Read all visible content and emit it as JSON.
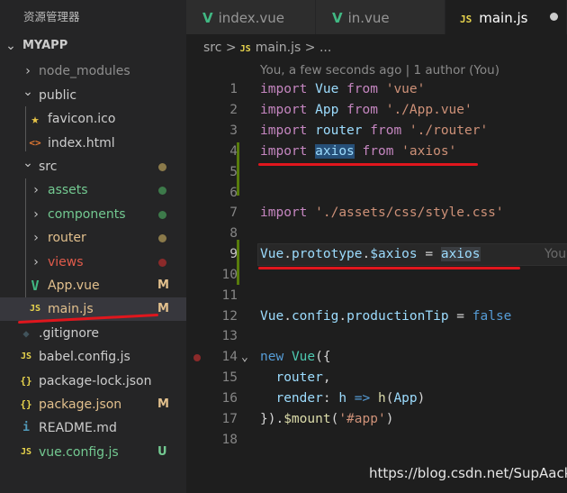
{
  "explorer": {
    "title": "资源管理器",
    "project": "MYAPP",
    "items": [
      {
        "label": "node_modules",
        "kind": "folder",
        "color": "#8f8f8f",
        "status": "",
        "dot": ""
      },
      {
        "label": "public",
        "kind": "folder-open",
        "color": "#cccccc",
        "status": "",
        "dot": ""
      },
      {
        "label": "favicon.ico",
        "kind": "star",
        "color": "#cccccc",
        "status": "",
        "dot": ""
      },
      {
        "label": "index.html",
        "kind": "html",
        "color": "#cccccc",
        "status": "",
        "dot": ""
      },
      {
        "label": "src",
        "kind": "folder-open",
        "color": "#cccccc",
        "status": "",
        "dot": "#8b7a4a"
      },
      {
        "label": "assets",
        "kind": "folder",
        "color": "#73c991",
        "status": "",
        "dot": "#3d7a4a"
      },
      {
        "label": "components",
        "kind": "folder",
        "color": "#73c991",
        "status": "",
        "dot": "#3d7a4a"
      },
      {
        "label": "router",
        "kind": "folder",
        "color": "#e2c08d",
        "status": "",
        "dot": "#8b7a4a"
      },
      {
        "label": "views",
        "kind": "folder",
        "color": "#e05b4b",
        "status": "",
        "dot": "#8b2a2a"
      },
      {
        "label": "App.vue",
        "kind": "vue",
        "color": "#e2c08d",
        "status": "M",
        "dot": ""
      },
      {
        "label": "main.js",
        "kind": "js",
        "color": "#e2c08d",
        "status": "M",
        "dot": ""
      },
      {
        "label": ".gitignore",
        "kind": "git",
        "color": "#cccccc",
        "status": "",
        "dot": ""
      },
      {
        "label": "babel.config.js",
        "kind": "js",
        "color": "#cccccc",
        "status": "",
        "dot": ""
      },
      {
        "label": "package-lock.json",
        "kind": "json",
        "color": "#cccccc",
        "status": "",
        "dot": ""
      },
      {
        "label": "package.json",
        "kind": "json",
        "color": "#e2c08d",
        "status": "M",
        "dot": ""
      },
      {
        "label": "README.md",
        "kind": "info",
        "color": "#cccccc",
        "status": "",
        "dot": ""
      },
      {
        "label": "vue.config.js",
        "kind": "js",
        "color": "#73c991",
        "status": "U",
        "dot": ""
      }
    ]
  },
  "tabs": [
    {
      "label": "index.vue",
      "icon": "V"
    },
    {
      "label": "in.vue",
      "icon": "V"
    },
    {
      "label": "main.js",
      "icon": "JS"
    }
  ],
  "breadcrumb": {
    "folder": "src",
    "sep": ">",
    "icon": "JS",
    "file": "main.js",
    "tail": "> ..."
  },
  "codelens": "You, a few seconds ago | 1 author (You)",
  "blame": "You",
  "line_numbers": [
    "1",
    "2",
    "3",
    "4",
    "5",
    "6",
    "7",
    "8",
    "9",
    "10",
    "11",
    "12",
    "13",
    "14",
    "15",
    "16",
    "17",
    "18"
  ],
  "code": {
    "l1": {
      "kw": "import",
      "name": "Vue",
      "from": "from",
      "src": "'vue'"
    },
    "l2": {
      "kw": "import",
      "name": "App",
      "from": "from",
      "src": "'./App.vue'"
    },
    "l3": {
      "kw": "import",
      "name": "router",
      "from": "from",
      "src": "'./router'"
    },
    "l4": {
      "kw": "import",
      "name": "axios",
      "from": "from",
      "src": "'axios'"
    },
    "l7": {
      "kw": "import",
      "src": "'./assets/css/style.css'"
    },
    "l9": {
      "obj": "Vue",
      "dot1": ".",
      "prop1": "prototype",
      "dot2": ".",
      "prop2": "$axios",
      "eq": " = ",
      "val": "axios"
    },
    "l12": {
      "obj": "Vue",
      "dot1": ".",
      "prop1": "config",
      "dot2": ".",
      "prop2": "productionTip",
      "eq": " = ",
      "val": "false"
    },
    "l14": {
      "kw": "new",
      "cls": "Vue",
      "rest": "({"
    },
    "l15": {
      "name": "router",
      "rest": ","
    },
    "l16": {
      "name": "render",
      "colon": ": ",
      "arg": "h",
      "arrow": " => ",
      "fn": "h",
      "open": "(",
      "app": "App",
      "close": ")"
    },
    "l17": {
      "close": "})",
      "dot": ".",
      "fn": "$mount",
      "open": "(",
      "str": "'#app'",
      "end": ")"
    }
  },
  "watermark": "https://blog.csdn.net/SupAack"
}
